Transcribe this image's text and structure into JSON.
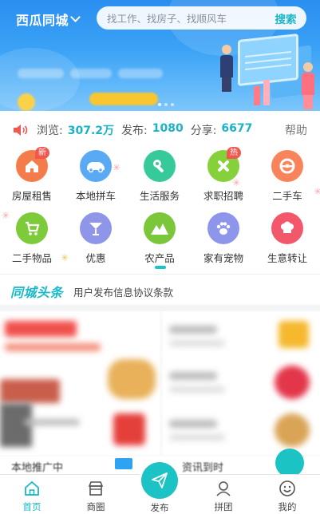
{
  "header": {
    "city": "西瓜同城",
    "search_placeholder": "找工作、找房子、找顺风车",
    "search_button": "搜索"
  },
  "stats": {
    "views_label": "浏览:",
    "views_value": "307.2万",
    "posts_label": "发布:",
    "posts_value": "1080",
    "shares_label": "分享:",
    "shares_value": "6677",
    "help": "帮助"
  },
  "categories": [
    {
      "label": "房屋租售",
      "color": "#f37c4a",
      "icon": "house-icon",
      "badge": "新"
    },
    {
      "label": "本地拼车",
      "color": "#5aa9f4",
      "icon": "car-icon",
      "badge": ""
    },
    {
      "label": "生活服务",
      "color": "#36c99a",
      "icon": "wrench-icon",
      "badge": ""
    },
    {
      "label": "求职招聘",
      "color": "#86d13b",
      "icon": "tools-icon",
      "badge": "热"
    },
    {
      "label": "二手车",
      "color": "#f9845b",
      "icon": "steering-wheel-icon",
      "badge": ""
    },
    {
      "label": "二手物品",
      "color": "#7dca3a",
      "icon": "cart-icon",
      "badge": ""
    },
    {
      "label": "优惠",
      "color": "#8f95e9",
      "icon": "cocktail-icon",
      "badge": ""
    },
    {
      "label": "农产品",
      "color": "#7bc63a",
      "icon": "mountain-icon",
      "badge": ""
    },
    {
      "label": "家有宠物",
      "color": "#8e96ec",
      "icon": "paw-icon",
      "badge": ""
    },
    {
      "label": "生意转让",
      "color": "#f2576a",
      "icon": "chef-hat-icon",
      "badge": ""
    }
  ],
  "headline": {
    "logo": "同城头条",
    "text": "用户发布信息协议条款"
  },
  "promo": {
    "bottom_left": "本地推广中",
    "bottom_right": "资讯到时"
  },
  "tabbar": {
    "home": "首页",
    "shop": "商圈",
    "publish": "发布",
    "group": "拼团",
    "mine": "我的"
  },
  "colors": {
    "accent": "#18b9c9",
    "badge": "#f2574f"
  }
}
